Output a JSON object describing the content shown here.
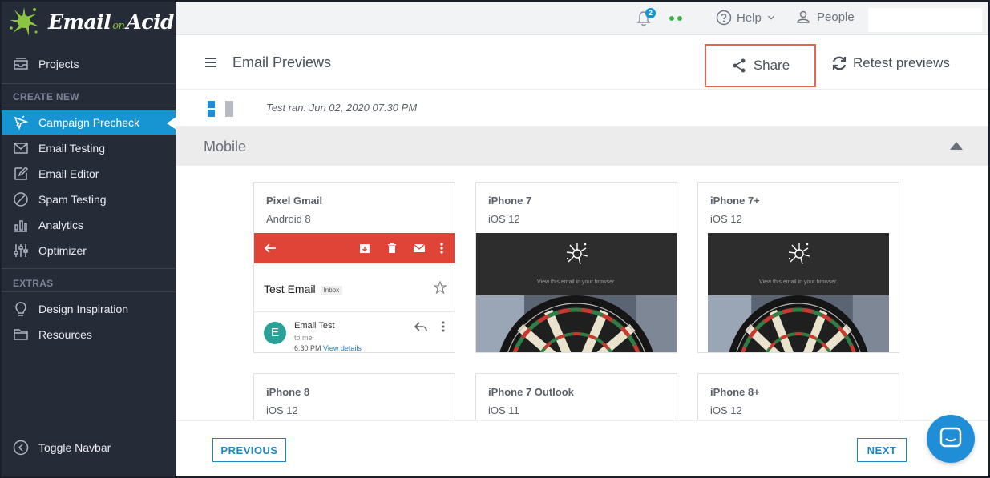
{
  "brand": {
    "name_part1": "Email",
    "name_on": "on",
    "name_part2": "Acid"
  },
  "sidebar": {
    "projects_label": "Projects",
    "create_new_label": "CREATE NEW",
    "items": [
      {
        "label": "Campaign Precheck",
        "icon": "campaign-precheck-icon",
        "active": true
      },
      {
        "label": "Email Testing",
        "icon": "envelope-icon"
      },
      {
        "label": "Email Editor",
        "icon": "edit-icon"
      },
      {
        "label": "Spam Testing",
        "icon": "block-icon"
      },
      {
        "label": "Analytics",
        "icon": "bar-chart-icon"
      },
      {
        "label": "Optimizer",
        "icon": "sliders-icon"
      }
    ],
    "extras_label": "EXTRAS",
    "extras": [
      {
        "label": "Design Inspiration",
        "icon": "lightbulb-icon"
      },
      {
        "label": "Resources",
        "icon": "folder-icon"
      }
    ],
    "toggle_label": "Toggle Navbar"
  },
  "topbar": {
    "notification_count": "2",
    "help_label": "Help",
    "people_label": "People"
  },
  "header": {
    "title": "Email Previews",
    "share_label": "Share",
    "retest_label": "Retest previews"
  },
  "test_ran": "Test ran: Jun 02, 2020 07:30 PM",
  "section": {
    "title": "Mobile"
  },
  "cards": [
    {
      "name": "Pixel Gmail",
      "os": "Android 8"
    },
    {
      "name": "iPhone 7",
      "os": "iOS 12"
    },
    {
      "name": "iPhone 7+",
      "os": "iOS 12"
    },
    {
      "name": "iPhone 8",
      "os": "iOS 12"
    },
    {
      "name": "iPhone 7 Outlook",
      "os": "iOS 11"
    },
    {
      "name": "iPhone 8+",
      "os": "iOS 12"
    }
  ],
  "gmail_preview": {
    "subject": "Test Email",
    "label": "Inbox",
    "avatar_letter": "E",
    "from": "Email Test",
    "to": "to me",
    "time": "6:30 PM",
    "view_details": "View details"
  },
  "iphone_preview": {
    "caption": "View this email in your browser."
  },
  "footer": {
    "previous_label": "PREVIOUS",
    "next_label": "NEXT"
  },
  "colors": {
    "sidebar_bg": "#262b38",
    "active_blue": "#1695d2",
    "share_border": "#e0664f",
    "gmail_red": "#e04437",
    "brand_green": "#8bc53f"
  }
}
